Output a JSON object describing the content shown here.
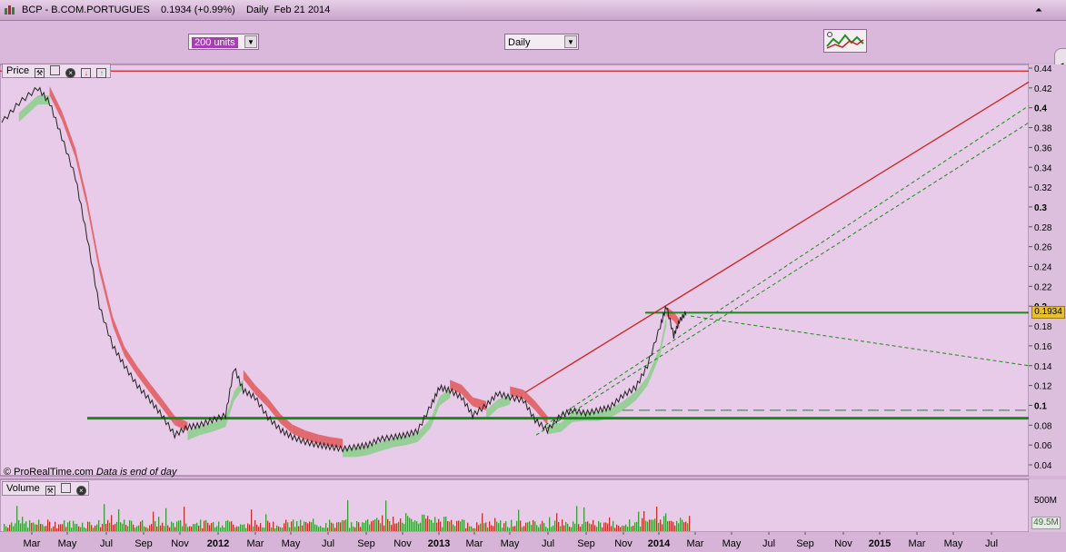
{
  "window": {
    "title": "BCP - B.COM.PORTUGUES",
    "last_price": "0.1934",
    "change": "(+0.99%)",
    "period": "Daily",
    "date": "Feb 21 2014"
  },
  "toolbar": {
    "units_value": "200 units",
    "period_value": "Daily"
  },
  "price_panel": {
    "label": "Price",
    "last_value_badge": "0.1934",
    "copyright": "© ProRealTime.com",
    "copyright_note": "Data is end of day"
  },
  "volume_panel": {
    "label": "Volume",
    "last_value_badge": "49.5M",
    "axis_label": "500M"
  },
  "colors": {
    "up_band": "#7ecf7e",
    "down_band": "#e04848",
    "price_line": "#222222",
    "support_line": "#1a8a1a",
    "resistance_line": "#cc2222",
    "volume_bars": "#3a9a3a"
  },
  "chart_data": {
    "type": "line",
    "title": "",
    "ylabel": "",
    "xlabel": "",
    "ylim": [
      0.03,
      0.45
    ],
    "y_ticks": [
      "0.44",
      "0.42",
      "0.4",
      "0.38",
      "0.36",
      "0.34",
      "0.32",
      "0.3",
      "0.28",
      "0.26",
      "0.24",
      "0.22",
      "0.2",
      "0.18",
      "0.16",
      "0.14",
      "0.12",
      "0.1",
      "0.08",
      "0.06",
      "0.04"
    ],
    "x_ticks": [
      "Mar",
      "May",
      "Jul",
      "Sep",
      "Nov",
      "2012",
      "Mar",
      "May",
      "Jul",
      "Sep",
      "Nov",
      "2013",
      "Mar",
      "May",
      "Jul",
      "Sep",
      "Nov",
      "2014",
      "Mar",
      "May",
      "Jul",
      "Sep",
      "Nov",
      "2015",
      "Mar",
      "May",
      "Jul"
    ],
    "x_range": [
      "2011-02-01",
      "2015-08-31"
    ],
    "grid": false,
    "series": [
      {
        "x": [
          "2011-02-01",
          "2011-03-01",
          "2011-04-01",
          "2011-04-20",
          "2011-05-10",
          "2011-06-01",
          "2011-06-20",
          "2011-07-10",
          "2011-08-01",
          "2011-08-20",
          "2011-09-10",
          "2011-10-01",
          "2011-10-20",
          "2011-11-10",
          "2011-12-01",
          "2011-12-20",
          "2012-01-10",
          "2012-02-01",
          "2012-02-15",
          "2012-03-01",
          "2012-03-20",
          "2012-04-10",
          "2012-05-01",
          "2012-05-20",
          "2012-06-10",
          "2012-07-01",
          "2012-07-20",
          "2012-08-10",
          "2012-09-01",
          "2012-09-20",
          "2012-10-10",
          "2012-11-01",
          "2012-11-20",
          "2012-12-10",
          "2013-01-01",
          "2013-01-15",
          "2013-02-01",
          "2013-02-20",
          "2013-03-10",
          "2013-04-01",
          "2013-04-20",
          "2013-05-10",
          "2013-06-01",
          "2013-06-20",
          "2013-07-10",
          "2013-08-01",
          "2013-08-20",
          "2013-09-10",
          "2013-10-01",
          "2013-10-20",
          "2013-11-10",
          "2013-12-01",
          "2013-12-20",
          "2014-01-10",
          "2014-01-20",
          "2014-02-01",
          "2014-02-10",
          "2014-02-21"
        ],
        "values": [
          0.385,
          0.405,
          0.42,
          0.405,
          0.37,
          0.33,
          0.27,
          0.2,
          0.16,
          0.14,
          0.12,
          0.105,
          0.09,
          0.07,
          0.078,
          0.08,
          0.085,
          0.09,
          0.138,
          0.115,
          0.108,
          0.088,
          0.075,
          0.068,
          0.063,
          0.06,
          0.058,
          0.056,
          0.058,
          0.06,
          0.066,
          0.068,
          0.07,
          0.074,
          0.1,
          0.118,
          0.115,
          0.108,
          0.09,
          0.1,
          0.112,
          0.108,
          0.105,
          0.085,
          0.075,
          0.09,
          0.095,
          0.092,
          0.095,
          0.098,
          0.11,
          0.118,
          0.14,
          0.18,
          0.2,
          0.17,
          0.185,
          0.1934
        ]
      }
    ],
    "support_lines": [
      0.087,
      0.1934
    ],
    "dashed_level": 0.095
  }
}
